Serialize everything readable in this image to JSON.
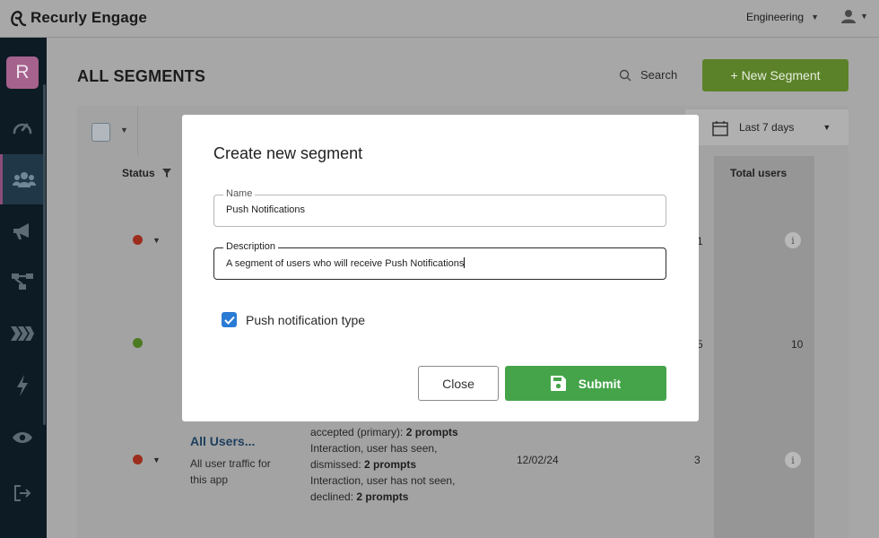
{
  "app": {
    "name": "Recurly Engage",
    "org_label": "Engineering"
  },
  "sidebar": {
    "avatar_letter": "R",
    "items": [
      {
        "icon": "gauge-icon"
      },
      {
        "icon": "users-icon",
        "active": true
      },
      {
        "icon": "megaphone-icon"
      },
      {
        "icon": "flow-icon"
      },
      {
        "icon": "chevrons-icon"
      },
      {
        "icon": "lightning-icon"
      },
      {
        "icon": "eye-icon"
      },
      {
        "icon": "logout-icon"
      }
    ]
  },
  "page": {
    "title": "ALL SEGMENTS",
    "search_label": "Search",
    "new_button": "+ New Segment",
    "date_range": "Last 7 days"
  },
  "table": {
    "columns": {
      "status": "Status",
      "total_users": "Total users"
    },
    "rows": [
      {
        "status": "inactive",
        "partial_value": "1",
        "total": ""
      },
      {
        "status": "active",
        "partial_value": "5",
        "total": "10"
      },
      {
        "status": "inactive",
        "name": "All Users...",
        "description": "All user traffic for this app",
        "prompts": [
          {
            "text": "accepted (primary): ",
            "count": "2 prompts"
          },
          {
            "text": "Interaction, user has seen, dismissed: ",
            "count": "2 prompts"
          },
          {
            "text": "Interaction, user has not seen, declined: ",
            "count": "2 prompts"
          }
        ],
        "date": "12/02/24",
        "partial_value": "3"
      }
    ]
  },
  "modal": {
    "title": "Create new segment",
    "name_label": "Name",
    "name_value": "Push Notifications",
    "description_label": "Description",
    "description_value": "A segment of users who will receive Push Notifications",
    "checkbox_label": "Push notification type",
    "checkbox_checked": true,
    "close_label": "Close",
    "submit_label": "Submit"
  },
  "colors": {
    "submit_green": "#45a44a",
    "new_segment_green": "#5c8229",
    "checkbox_blue": "#2a7bd4",
    "sidebar_bg": "#0d1b24",
    "link_blue": "#1d3f5e",
    "status_red": "#9c2d1d",
    "status_green": "#4b7a21"
  }
}
